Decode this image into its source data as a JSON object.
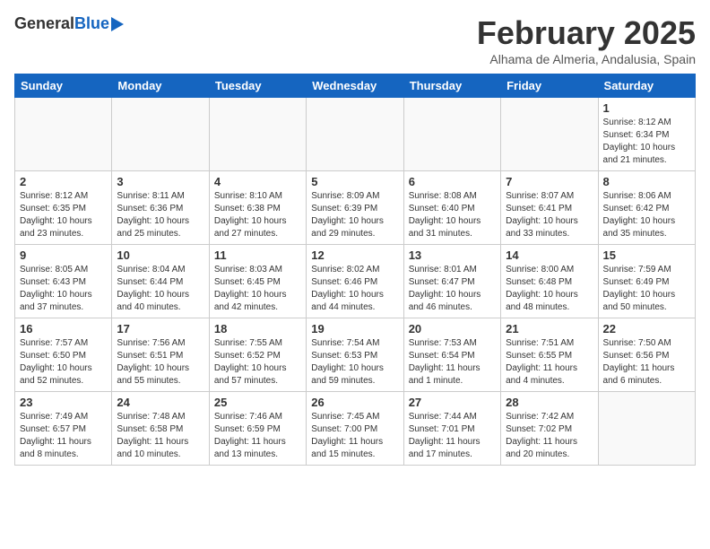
{
  "header": {
    "logo_general": "General",
    "logo_blue": "Blue",
    "month_title": "February 2025",
    "subtitle": "Alhama de Almeria, Andalusia, Spain"
  },
  "days_of_week": [
    "Sunday",
    "Monday",
    "Tuesday",
    "Wednesday",
    "Thursday",
    "Friday",
    "Saturday"
  ],
  "weeks": [
    [
      {
        "day": "",
        "info": ""
      },
      {
        "day": "",
        "info": ""
      },
      {
        "day": "",
        "info": ""
      },
      {
        "day": "",
        "info": ""
      },
      {
        "day": "",
        "info": ""
      },
      {
        "day": "",
        "info": ""
      },
      {
        "day": "1",
        "info": "Sunrise: 8:12 AM\nSunset: 6:34 PM\nDaylight: 10 hours and 21 minutes."
      }
    ],
    [
      {
        "day": "2",
        "info": "Sunrise: 8:12 AM\nSunset: 6:35 PM\nDaylight: 10 hours and 23 minutes."
      },
      {
        "day": "3",
        "info": "Sunrise: 8:11 AM\nSunset: 6:36 PM\nDaylight: 10 hours and 25 minutes."
      },
      {
        "day": "4",
        "info": "Sunrise: 8:10 AM\nSunset: 6:38 PM\nDaylight: 10 hours and 27 minutes."
      },
      {
        "day": "5",
        "info": "Sunrise: 8:09 AM\nSunset: 6:39 PM\nDaylight: 10 hours and 29 minutes."
      },
      {
        "day": "6",
        "info": "Sunrise: 8:08 AM\nSunset: 6:40 PM\nDaylight: 10 hours and 31 minutes."
      },
      {
        "day": "7",
        "info": "Sunrise: 8:07 AM\nSunset: 6:41 PM\nDaylight: 10 hours and 33 minutes."
      },
      {
        "day": "8",
        "info": "Sunrise: 8:06 AM\nSunset: 6:42 PM\nDaylight: 10 hours and 35 minutes."
      }
    ],
    [
      {
        "day": "9",
        "info": "Sunrise: 8:05 AM\nSunset: 6:43 PM\nDaylight: 10 hours and 37 minutes."
      },
      {
        "day": "10",
        "info": "Sunrise: 8:04 AM\nSunset: 6:44 PM\nDaylight: 10 hours and 40 minutes."
      },
      {
        "day": "11",
        "info": "Sunrise: 8:03 AM\nSunset: 6:45 PM\nDaylight: 10 hours and 42 minutes."
      },
      {
        "day": "12",
        "info": "Sunrise: 8:02 AM\nSunset: 6:46 PM\nDaylight: 10 hours and 44 minutes."
      },
      {
        "day": "13",
        "info": "Sunrise: 8:01 AM\nSunset: 6:47 PM\nDaylight: 10 hours and 46 minutes."
      },
      {
        "day": "14",
        "info": "Sunrise: 8:00 AM\nSunset: 6:48 PM\nDaylight: 10 hours and 48 minutes."
      },
      {
        "day": "15",
        "info": "Sunrise: 7:59 AM\nSunset: 6:49 PM\nDaylight: 10 hours and 50 minutes."
      }
    ],
    [
      {
        "day": "16",
        "info": "Sunrise: 7:57 AM\nSunset: 6:50 PM\nDaylight: 10 hours and 52 minutes."
      },
      {
        "day": "17",
        "info": "Sunrise: 7:56 AM\nSunset: 6:51 PM\nDaylight: 10 hours and 55 minutes."
      },
      {
        "day": "18",
        "info": "Sunrise: 7:55 AM\nSunset: 6:52 PM\nDaylight: 10 hours and 57 minutes."
      },
      {
        "day": "19",
        "info": "Sunrise: 7:54 AM\nSunset: 6:53 PM\nDaylight: 10 hours and 59 minutes."
      },
      {
        "day": "20",
        "info": "Sunrise: 7:53 AM\nSunset: 6:54 PM\nDaylight: 11 hours and 1 minute."
      },
      {
        "day": "21",
        "info": "Sunrise: 7:51 AM\nSunset: 6:55 PM\nDaylight: 11 hours and 4 minutes."
      },
      {
        "day": "22",
        "info": "Sunrise: 7:50 AM\nSunset: 6:56 PM\nDaylight: 11 hours and 6 minutes."
      }
    ],
    [
      {
        "day": "23",
        "info": "Sunrise: 7:49 AM\nSunset: 6:57 PM\nDaylight: 11 hours and 8 minutes."
      },
      {
        "day": "24",
        "info": "Sunrise: 7:48 AM\nSunset: 6:58 PM\nDaylight: 11 hours and 10 minutes."
      },
      {
        "day": "25",
        "info": "Sunrise: 7:46 AM\nSunset: 6:59 PM\nDaylight: 11 hours and 13 minutes."
      },
      {
        "day": "26",
        "info": "Sunrise: 7:45 AM\nSunset: 7:00 PM\nDaylight: 11 hours and 15 minutes."
      },
      {
        "day": "27",
        "info": "Sunrise: 7:44 AM\nSunset: 7:01 PM\nDaylight: 11 hours and 17 minutes."
      },
      {
        "day": "28",
        "info": "Sunrise: 7:42 AM\nSunset: 7:02 PM\nDaylight: 11 hours and 20 minutes."
      },
      {
        "day": "",
        "info": ""
      }
    ]
  ]
}
